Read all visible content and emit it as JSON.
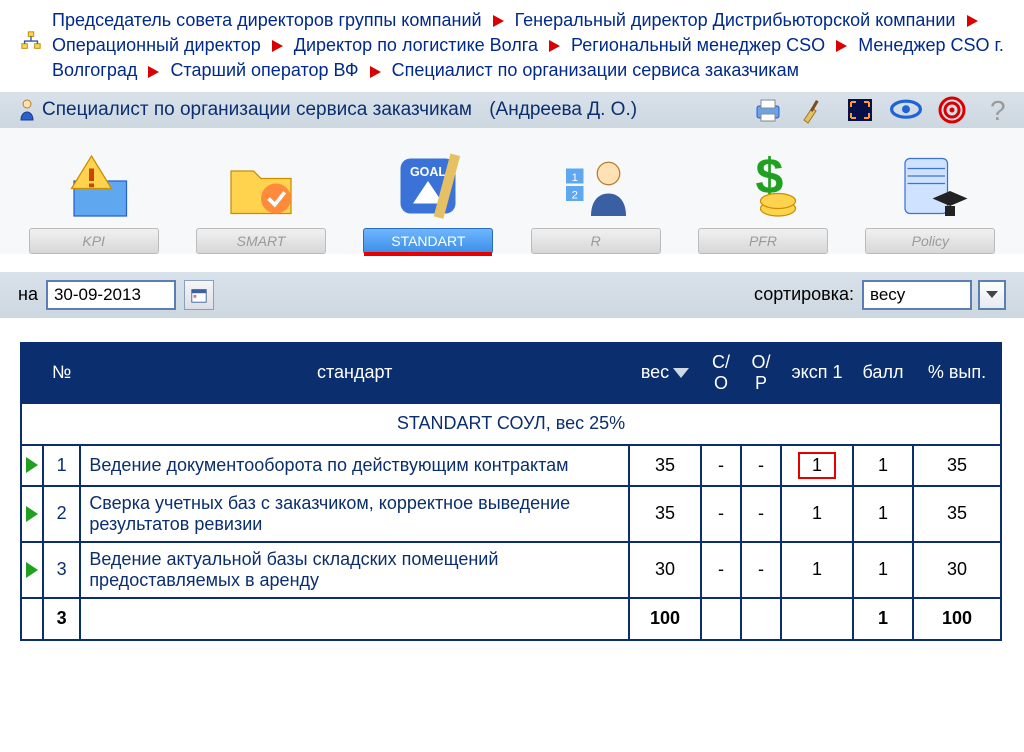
{
  "breadcrumb": {
    "items": [
      "Председатель совета директоров группы компаний",
      "Генеральный директор Дистрибьюторской компании",
      "Операционный директор",
      "Директор по логистике Волга",
      "Региональный менеджер CSO",
      "Менеджер CSO г. Волгоград",
      "Старший оператор ВФ",
      "Специалист по организации сервиса заказчикам"
    ]
  },
  "titlebar": {
    "role": "Специалист по организации сервиса заказчикам",
    "user": "(Андреева Д. О.)"
  },
  "tabs": [
    {
      "label": "KPI",
      "icon": "warning-grid",
      "active": false
    },
    {
      "label": "SMART",
      "icon": "folder-check",
      "active": false
    },
    {
      "label": "STANDART",
      "icon": "goal-badge",
      "active": true
    },
    {
      "label": "R",
      "icon": "people-rank",
      "active": false
    },
    {
      "label": "PFR",
      "icon": "money-dollar",
      "active": false
    },
    {
      "label": "Policy",
      "icon": "doc-cap",
      "active": false
    }
  ],
  "filterbar": {
    "date_label": "на",
    "date_value": "30-09-2013",
    "sort_label": "сортировка:",
    "sort_value": "весу"
  },
  "table": {
    "headers": {
      "num": "№",
      "name": "стандарт",
      "ves": "вес",
      "co": "С/О",
      "op": "О/Р",
      "eksp": "эксп 1",
      "ball": "балл",
      "vyp": "% вып."
    },
    "section_title": "STANDART СОУЛ, вес 25%",
    "rows": [
      {
        "num": "1",
        "name": "Ведение документооборота по действующим контрактам",
        "ves": "35",
        "co": "-",
        "op": "-",
        "eksp": "1",
        "eksp_highlight": true,
        "ball": "1",
        "vyp": "35"
      },
      {
        "num": "2",
        "name": "Сверка учетных баз с заказчиком, корректное выведение результатов ревизии",
        "ves": "35",
        "co": "-",
        "op": "-",
        "eksp": "1",
        "eksp_highlight": false,
        "ball": "1",
        "vyp": "35"
      },
      {
        "num": "3",
        "name": "Ведение актуальной базы складских помещений предоставляемых в аренду",
        "ves": "30",
        "co": "-",
        "op": "-",
        "eksp": "1",
        "eksp_highlight": false,
        "ball": "1",
        "vyp": "30"
      }
    ],
    "totals": {
      "count": "3",
      "ves": "100",
      "ball": "1",
      "vyp": "100"
    }
  }
}
